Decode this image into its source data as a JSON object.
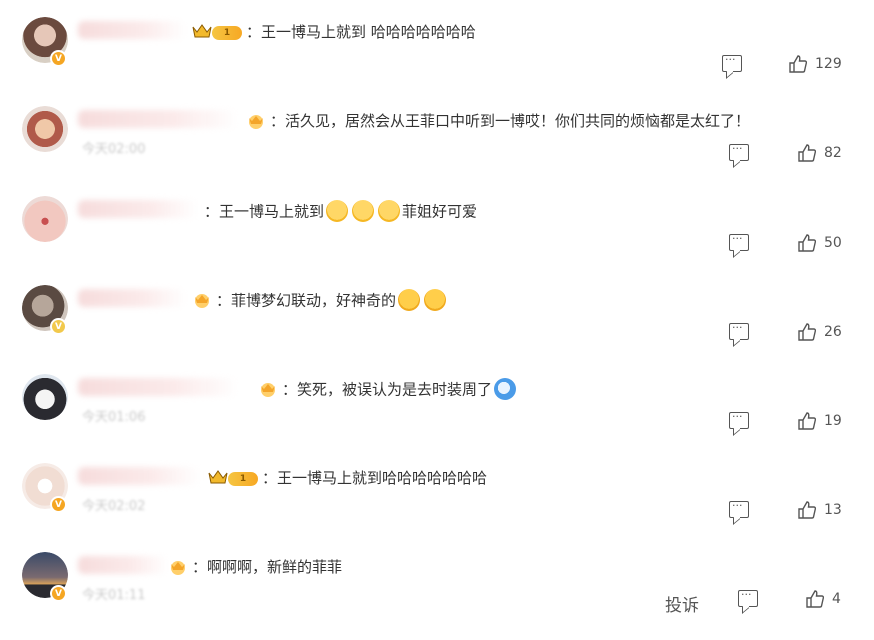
{
  "comments": [
    {
      "text": "：王一博马上就到 哈哈哈哈哈哈哈",
      "likes": "129",
      "has_level": true,
      "level": "1",
      "has_crown": true,
      "avatar_color": "#8a6b5a",
      "badge": "V",
      "time": "",
      "emojis": []
    },
    {
      "text": "：活久见，居然会从王菲口中听到一博哎！你们共同的烦恼都是太红了！",
      "likes": "82",
      "has_fan": true,
      "avatar_color": "#c98a7a",
      "time": "今天02:00",
      "emojis": []
    },
    {
      "text_before": "：王一博马上就到",
      "text_after": "菲姐好可爱",
      "likes": "50",
      "avatar_color": "#e3b5b0",
      "time": "",
      "emojis": [
        "laugh-emoji",
        "laugh-emoji",
        "laugh-emoji"
      ]
    },
    {
      "text_before": "：菲博梦幻联动，好神奇的",
      "text_after": "",
      "likes": "26",
      "has_fan": true,
      "avatar_color": "#6e5b50",
      "badge": "V",
      "time": "",
      "emojis": [
        "heart-eyes-emoji",
        "heart-eyes-emoji"
      ]
    },
    {
      "text_before": "：笑死，被误认为是去时装周了",
      "text_after": "",
      "likes": "19",
      "has_fan": true,
      "avatar_color": "#2b2b33",
      "time": "今天01:06",
      "emojis": [
        "blue-face-emoji"
      ]
    },
    {
      "text": "：王一博马上就到哈哈哈哈哈哈哈",
      "likes": "13",
      "has_level": true,
      "level": "1",
      "has_crown": true,
      "avatar_color": "#efdad0",
      "badge": "V",
      "time": "今天02:02"
    },
    {
      "text": "：啊啊啊，新鲜的菲菲",
      "likes": "4",
      "has_fan": true,
      "avatar_color": "#46526b",
      "badge": "V",
      "time": "今天01:11",
      "report_label": "投诉"
    }
  ],
  "colors": {
    "text": "#333333",
    "muted": "#555555",
    "badge": "#f5a623"
  }
}
